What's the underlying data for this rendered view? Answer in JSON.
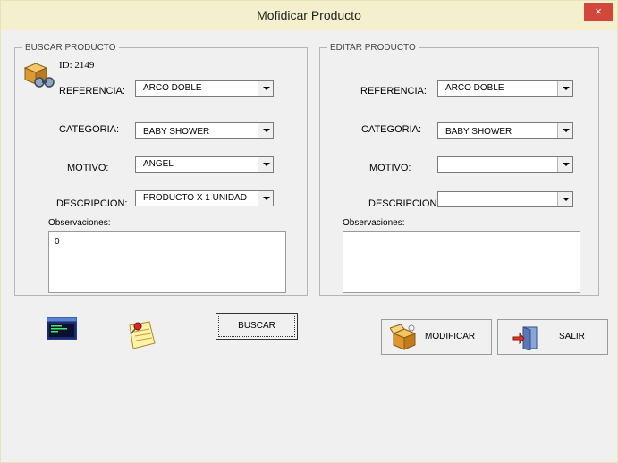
{
  "window": {
    "title": "Mofidicar Producto",
    "close_glyph": "×"
  },
  "buscar": {
    "legend": "BUSCAR PRODUCTO",
    "id_text": "ID:  2149",
    "referencia_label": "REFERENCIA:",
    "referencia_value": "ARCO DOBLE",
    "categoria_label": "CATEGORIA:",
    "categoria_value": "BABY SHOWER",
    "motivo_label": "MOTIVO:",
    "motivo_value": "ANGEL",
    "descripcion_label": "DESCRIPCION:",
    "descripcion_value": "PRODUCTO X 1 UNIDAD",
    "observaciones_label": "Observaciones:",
    "observaciones_value": "0"
  },
  "editar": {
    "legend": "EDITAR PRODUCTO",
    "referencia_label": "REFERENCIA:",
    "referencia_value": "ARCO DOBLE",
    "categoria_label": "CATEGORIA:",
    "categoria_value": "BABY SHOWER",
    "motivo_label": "MOTIVO:",
    "motivo_value": "",
    "descripcion_label": "DESCRIPCION:",
    "descripcion_value": "",
    "observaciones_label": "Observaciones:",
    "observaciones_value": ""
  },
  "buttons": {
    "buscar": "BUSCAR",
    "modificar": "MODIFICAR",
    "salir": "SALIR"
  },
  "icons": [
    "package-search-icon",
    "terminal-icon",
    "notepad-pin-icon",
    "box-open-icon",
    "exit-door-icon"
  ],
  "colors": {
    "title_bar": "#f4efcd",
    "close_button": "#d2473a",
    "window_bg": "#f0f0f0"
  }
}
